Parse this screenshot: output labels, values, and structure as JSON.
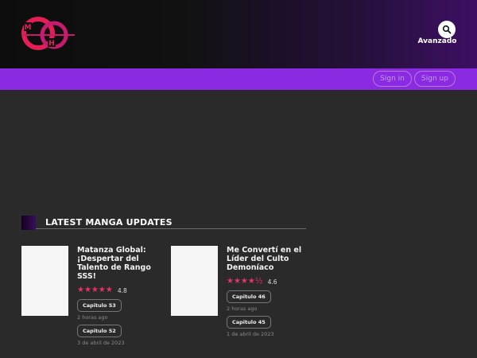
{
  "header": {
    "logo_letters": [
      "M",
      "H"
    ],
    "advanced_label": "Avanzado",
    "search_icon": "search-icon"
  },
  "nav": {
    "signin_label": "Sign in",
    "signup_label": "Sign up"
  },
  "section": {
    "title": "LATEST MANGA UPDATES"
  },
  "manga": [
    {
      "title_lines": [
        "Matanza Global:",
        "¡Despertar del",
        "Talento de Rango",
        "SSS!"
      ],
      "stars": "★★★★★",
      "rating": "4.8",
      "chapters": [
        {
          "label": "Capitulo 53",
          "time": "2 horas ago"
        },
        {
          "label": "Capitulo 52",
          "time": "3 de abril de 2023"
        }
      ]
    },
    {
      "title_lines": [
        "Me Convertí en el",
        "Líder del Culto",
        "Demoníaco"
      ],
      "stars": "★★★★½",
      "rating": "4.6",
      "chapters": [
        {
          "label": "Capitulo 46",
          "time": "2 horas ago"
        },
        {
          "label": "Capitulo 45",
          "time": "1 de abril de 2023"
        }
      ]
    }
  ],
  "colors": {
    "accent": "#8a2be2",
    "star": "#e8336a",
    "logo_red": "#e61e57"
  }
}
